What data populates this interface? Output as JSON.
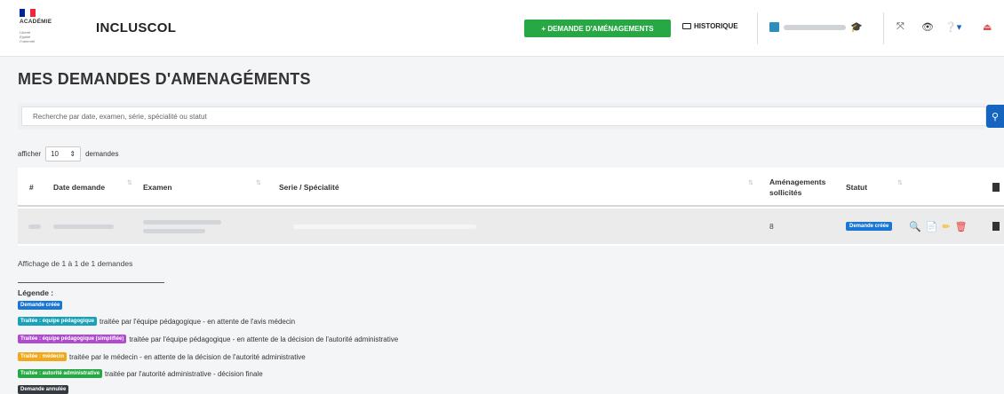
{
  "header": {
    "logo_text": "ACADÉMIE",
    "motto": "Liberté Égalité Fraternité",
    "app_title": "INCLUSCOL",
    "new_request_label": "+ DEMANDE D'AMÉNAGEMENTS",
    "history_label": "HISTORIQUE",
    "colors": {
      "green": "#28a745",
      "blue": "#1565c0",
      "flag_blue": "#002395",
      "flag_red": "#ed2939"
    }
  },
  "page": {
    "title": "MES DEMANDES D'AMENAGÉMENTS"
  },
  "search": {
    "placeholder": "Recherche par date, examen, série, spécialité ou statut"
  },
  "length": {
    "prefix": "afficher",
    "value": "10",
    "suffix": "demandes"
  },
  "table": {
    "columns": {
      "num": "#",
      "date": "Date demande",
      "exam": "Examen",
      "serie": "Serie / Spécialité",
      "amenag_1": "Aménagements",
      "amenag_2": "sollicités",
      "status": "Statut"
    },
    "rows": [
      {
        "amenagements": "8",
        "status": "Demande créée"
      }
    ]
  },
  "info": "Affichage de 1 à 1 de 1 demandes",
  "legend": {
    "title": "Légende :",
    "items": [
      {
        "badge": "Demande créée",
        "text": "",
        "color": "#1976d2"
      },
      {
        "badge": "Traitée : équipe pédagogique",
        "text": "traitée par l'équipe pédagogique - en attente de l'avis médecin",
        "color": "#17a2b8"
      },
      {
        "badge": "Traitée : équipe pédagogique (simplifiée)",
        "text": "traitée par l'équipe pédagogique - en attente de la décision de l'autorité administrative",
        "color": "#b04bd0"
      },
      {
        "badge": "Traitée : médecin",
        "text": "traitée par le médecin - en attente de la décision de l'autorité administrative",
        "color": "#f0a818"
      },
      {
        "badge": "Traitée : autorité administrative",
        "text": "traitée par l'autorité administrative - décision finale",
        "color": "#28a745"
      },
      {
        "badge": "Demande annulée",
        "text": "",
        "color": "#343a40"
      }
    ]
  }
}
